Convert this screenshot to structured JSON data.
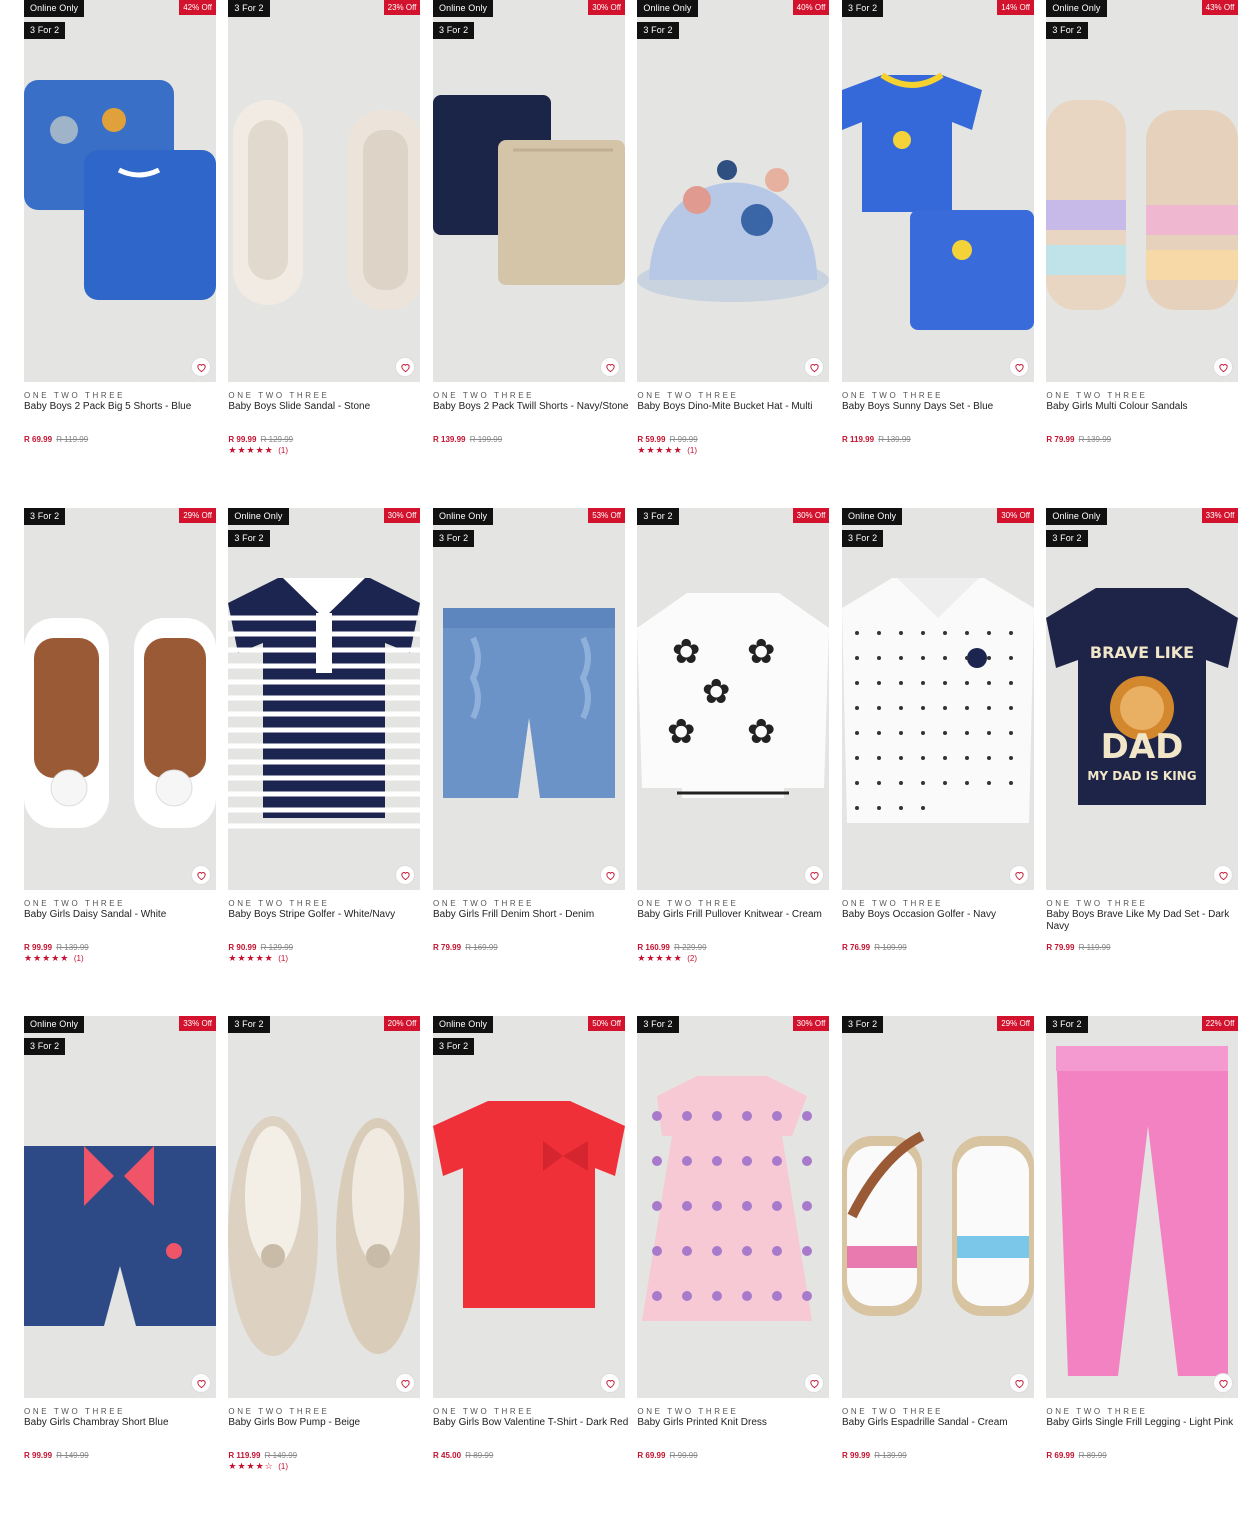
{
  "brand_label": "ONE TWO THREE",
  "colors": {
    "badge_bg": "#111111",
    "discount_bg": "#d3122e",
    "price": "#c41230",
    "image_bg": "#e4e4e2"
  },
  "products": [
    {
      "badges": [
        "Online Only",
        "3 For 2"
      ],
      "discount": "42% Off",
      "name": "Baby Boys 2 Pack Big 5 Shorts - Blue",
      "price": "R 69.99",
      "was": "R 119.99",
      "rating": null,
      "image_icon": "shorts-2pack-blue-image"
    },
    {
      "badges": [
        "3 For 2"
      ],
      "discount": "23% Off",
      "name": "Baby Boys Slide Sandal - Stone",
      "price": "R 99.99",
      "was": "R 129.99",
      "rating": {
        "stars": "★★★★★",
        "count": "(1)"
      },
      "image_icon": "slide-sandal-image"
    },
    {
      "badges": [
        "Online Only",
        "3 For 2"
      ],
      "discount": "30% Off",
      "name": "Baby Boys 2 Pack Twill Shorts - Navy/Stone",
      "price": "R 139.99",
      "was": "R 199.99",
      "rating": null,
      "image_icon": "twill-shorts-image"
    },
    {
      "badges": [
        "Online Only",
        "3 For 2"
      ],
      "discount": "40% Off",
      "name": "Baby Boys Dino-Mite Bucket Hat - Multi",
      "price": "R 59.99",
      "was": "R 99.99",
      "rating": {
        "stars": "★★★★★",
        "count": "(1)"
      },
      "image_icon": "bucket-hat-image"
    },
    {
      "badges": [
        "3 For 2"
      ],
      "discount": "14% Off",
      "name": "Baby Boys Sunny Days Set - Blue",
      "price": "R 119.99",
      "was": "R 139.99",
      "rating": null,
      "image_icon": "tshirt-shorts-set-image"
    },
    {
      "badges": [
        "Online Only",
        "3 For 2"
      ],
      "discount": "43% Off",
      "name": "Baby Girls Multi Colour Sandals",
      "price": "R 79.99",
      "was": "R 139.99",
      "rating": null,
      "image_icon": "rainbow-sandals-image"
    },
    {
      "badges": [
        "3 For 2"
      ],
      "discount": "29% Off",
      "name": "Baby Girls Daisy Sandal - White",
      "price": "R 99.99",
      "was": "R 139.99",
      "rating": {
        "stars": "★★★★★",
        "count": "(1)"
      },
      "image_icon": "daisy-sandal-image"
    },
    {
      "badges": [
        "Online Only",
        "3 For 2"
      ],
      "discount": "30% Off",
      "name": "Baby Boys Stripe Golfer - White/Navy",
      "price": "R 90.99",
      "was": "R 129.99",
      "rating": {
        "stars": "★★★★★",
        "count": "(1)"
      },
      "image_icon": "stripe-golfer-image"
    },
    {
      "badges": [
        "Online Only",
        "3 For 2"
      ],
      "discount": "53% Off",
      "name": "Baby Girls Frill Denim Short - Denim",
      "price": "R 79.99",
      "was": "R 169.99",
      "rating": null,
      "image_icon": "denim-short-image"
    },
    {
      "badges": [
        "3 For 2"
      ],
      "discount": "30% Off",
      "name": "Baby Girls Frill Pullover Knitwear - Cream",
      "price": "R 160.99",
      "was": "R 229.99",
      "rating": {
        "stars": "★★★★★",
        "count": "(2)"
      },
      "image_icon": "knit-pullover-image"
    },
    {
      "badges": [
        "Online Only",
        "3 For 2"
      ],
      "discount": "30% Off",
      "name": "Baby Boys Occasion Golfer - Navy",
      "price": "R 76.99",
      "was": "R 109.99",
      "rating": null,
      "image_icon": "occasion-golfer-image"
    },
    {
      "badges": [
        "Online Only",
        "3 For 2"
      ],
      "discount": "33% Off",
      "name": "Baby Boys Brave Like My Dad Set - Dark Navy",
      "price": "R 79.99",
      "was": "R 119.99",
      "rating": null,
      "image_icon": "brave-dad-tshirt-image",
      "print": [
        "BRAVE LIKE",
        "DAD",
        "MY DAD IS KING"
      ]
    },
    {
      "badges": [
        "Online Only",
        "3 For 2"
      ],
      "discount": "33% Off",
      "name": "Baby Girls Chambray Short Blue",
      "price": "R 99.99",
      "was": "R 149.99",
      "rating": null,
      "image_icon": "chambray-short-image"
    },
    {
      "badges": [
        "3 For 2"
      ],
      "discount": "20% Off",
      "name": "Baby Girls Bow Pump - Beige",
      "price": "R 119.99",
      "was": "R 149.99",
      "rating": {
        "stars": "★★★★☆",
        "count": "(1)"
      },
      "image_icon": "bow-pump-image"
    },
    {
      "badges": [
        "Online Only",
        "3 For 2"
      ],
      "discount": "50% Off",
      "name": "Baby Girls Bow Valentine T-Shirt - Dark Red",
      "price": "R 45.00",
      "was": "R 89.99",
      "rating": null,
      "image_icon": "red-tshirt-image"
    },
    {
      "badges": [
        "3 For 2"
      ],
      "discount": "30% Off",
      "name": "Baby Girls Printed Knit Dress",
      "price": "R 69.99",
      "was": "R 99.99",
      "rating": null,
      "image_icon": "floral-dress-image"
    },
    {
      "badges": [
        "3 For 2"
      ],
      "discount": "29% Off",
      "name": "Baby Girls Espadrille Sandal - Cream",
      "price": "R 99.99",
      "was": "R 139.99",
      "rating": null,
      "image_icon": "espadrille-sandal-image"
    },
    {
      "badges": [
        "3 For 2"
      ],
      "discount": "22% Off",
      "name": "Baby Girls Single Frill Legging - Light Pink",
      "price": "R 69.99",
      "was": "R 89.99",
      "rating": null,
      "image_icon": "pink-legging-image"
    }
  ]
}
